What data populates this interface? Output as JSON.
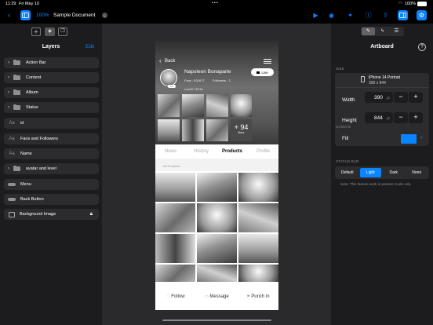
{
  "status_bar": {
    "time": "11:29",
    "date": "Fri May 10",
    "battery": "100%"
  },
  "toolbar": {
    "zoom": "100%",
    "doc_title": "Sample Document"
  },
  "layers_panel": {
    "title": "Layers",
    "edit": "Edit",
    "items": [
      {
        "label": "Action Bar"
      },
      {
        "label": "Content"
      },
      {
        "label": "Album"
      },
      {
        "label": "Status"
      },
      {
        "label": "id"
      },
      {
        "label": "Fans and Followers"
      },
      {
        "label": "Name"
      },
      {
        "label": "avatar and level"
      },
      {
        "label": "Menu"
      },
      {
        "label": "Back Button"
      },
      {
        "label": "Background Image"
      }
    ]
  },
  "phone": {
    "back": "Back",
    "name": "Napoleon Bonaparte",
    "live": "Live",
    "fans": "Fans : 501677",
    "followers": "Followers : 2",
    "live_id": "LiveID 15710",
    "more_count": "+ 94",
    "more_label": "More",
    "tabs": [
      "News",
      "History",
      "Products",
      "Profile"
    ],
    "active_tab": "Products",
    "all_products": "All Products",
    "actions": {
      "follow": "Follow",
      "message": "Message",
      "punch": "Punch in"
    }
  },
  "inspector": {
    "title": "Artboard",
    "size_label": "SIZE",
    "device": "iPhone 14 Portrait",
    "device_dims": "390 x 844",
    "width_label": "Width",
    "width_value": "390",
    "height_label": "Height",
    "height_value": "844",
    "unit": "pt",
    "canvas_label": "CANVAS",
    "fill_label": "Fill",
    "fill_color": "#0a84ff",
    "status_bar_label": "STATUS BAR",
    "status_options": [
      "Default",
      "Light",
      "Dark",
      "None"
    ],
    "status_selected": "Light",
    "note": "Note: This feature work in present mode only."
  },
  "colors": {
    "accent": "#0a84ff",
    "panel": "#1c1c1e",
    "row": "#2c2c2e",
    "canvas": "#2a2a2c"
  }
}
